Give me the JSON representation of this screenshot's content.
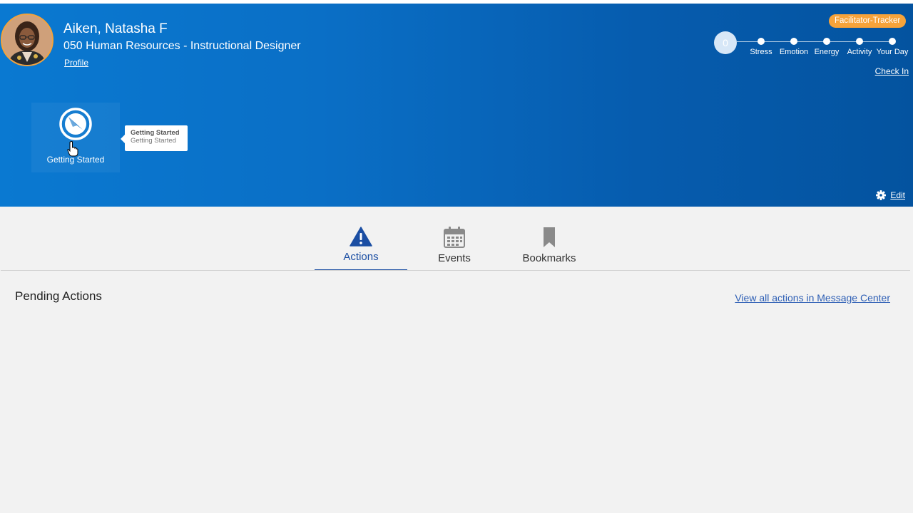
{
  "colors": {
    "banner_start": "#0a79d1",
    "banner_end": "#04539f",
    "badge": "#f7a33a",
    "accent": "#1b4ea3",
    "link": "#2e5fb5"
  },
  "header": {
    "name": "Aiken, Natasha F",
    "role": "050 Human Resources - Instructional Designer",
    "profile_link": "Profile",
    "badge": "Facilitator-Tracker",
    "checkin_link": "Check In",
    "edit_link": "Edit",
    "tracker": {
      "score": "0",
      "labels": [
        "Stress",
        "Emotion",
        "Energy",
        "Activity",
        "Your Day"
      ]
    }
  },
  "tile": {
    "label": "Getting Started",
    "icon": "compass-icon"
  },
  "tooltip": {
    "title": "Getting Started",
    "subtitle": "Getting Started"
  },
  "tabs": [
    {
      "label": "Actions",
      "icon": "warning-icon",
      "active": true
    },
    {
      "label": "Events",
      "icon": "calendar-icon",
      "active": false
    },
    {
      "label": "Bookmarks",
      "icon": "bookmark-icon",
      "active": false
    }
  ],
  "main": {
    "section_title": "Pending Actions",
    "message_center_link": "View all actions in Message Center"
  }
}
